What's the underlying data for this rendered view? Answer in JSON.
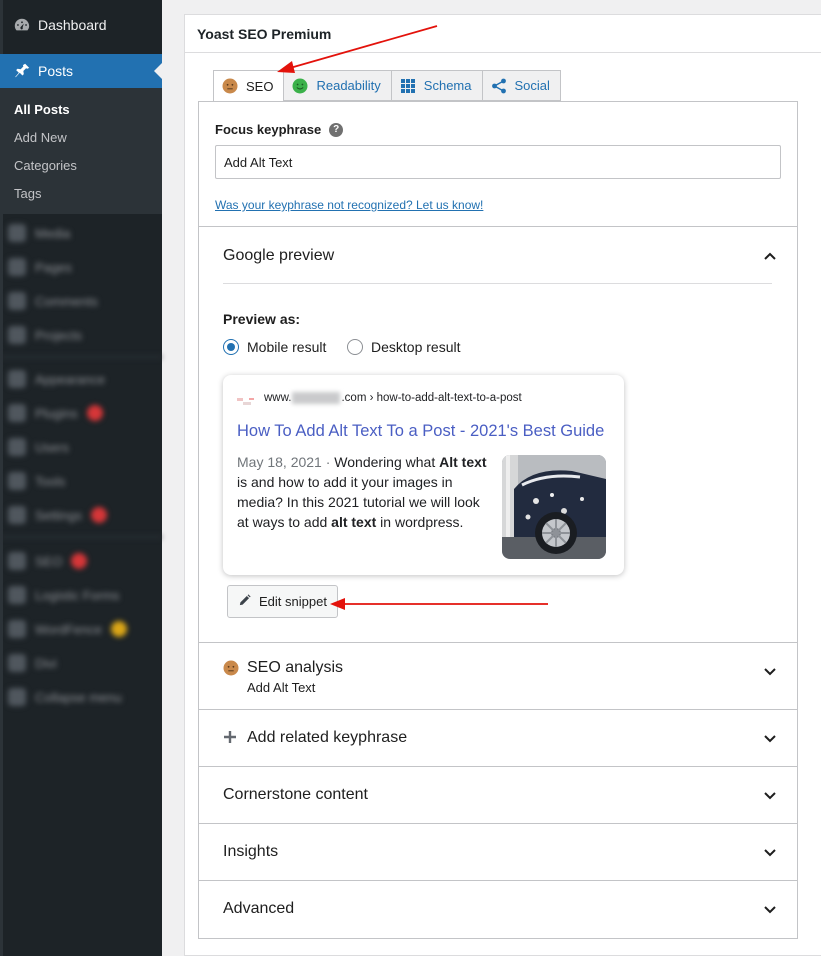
{
  "sidebar": {
    "dashboard_label": "Dashboard",
    "posts_label": "Posts",
    "submenu": [
      {
        "label": "All Posts",
        "current": true
      },
      {
        "label": "Add New",
        "current": false
      },
      {
        "label": "Categories",
        "current": false
      },
      {
        "label": "Tags",
        "current": false
      }
    ],
    "blurred_items": [
      "Media",
      "Pages",
      "Comments",
      "Projects",
      "Appearance",
      "Plugins",
      "Users",
      "Tools",
      "Settings",
      "SEO",
      "Logistic Forms",
      "WordFence",
      "Divi",
      "Collapse menu"
    ]
  },
  "yoast": {
    "title": "Yoast SEO Premium",
    "tabs": [
      {
        "label": "SEO",
        "icon": "face-neutral-icon",
        "active": true
      },
      {
        "label": "Readability",
        "icon": "face-smile-icon",
        "active": false
      },
      {
        "label": "Schema",
        "icon": "grid-icon",
        "active": false
      },
      {
        "label": "Social",
        "icon": "share-icon",
        "active": false
      }
    ],
    "focus_keyphrase_label": "Focus keyphrase",
    "focus_keyphrase_value": "Add Alt Text",
    "keyphrase_link": "Was your keyphrase not recognized? Let us know!",
    "google_preview": {
      "title": "Google preview",
      "preview_as_label": "Preview as:",
      "options": [
        "Mobile result",
        "Desktop result"
      ],
      "selected": "Mobile result",
      "serp": {
        "url_prefix": "www.",
        "url_suffix": ".com › how-to-add-alt-text-to-a-post",
        "title": "How To Add Alt Text To a Post - 2021's Best Guide",
        "date": "May 18, 2021",
        "separator": " · ",
        "desc_1": "Wondering what ",
        "desc_bold_1": "Alt text",
        "desc_2": " is and how to add it your images in media? In this 2021 tutorial we will look at ways to add ",
        "desc_bold_2": "alt text",
        "desc_3": " in wordpress."
      },
      "edit_snippet_label": "Edit snippet"
    },
    "seo_analysis": {
      "title": "SEO analysis",
      "subtitle": "Add Alt Text"
    },
    "related_keyphrase_label": "Add related keyphrase",
    "cornerstone_label": "Cornerstone content",
    "insights_label": "Insights",
    "advanced_label": "Advanced"
  },
  "colors": {
    "sidebar_bg": "#1d2327",
    "active_menu": "#2271b1",
    "link": "#2271b1",
    "serp_title": "#4a5ec3",
    "seo_score_orange": "#c9894b",
    "readability_green": "#3bb14a",
    "annotation_red": "#e3120b"
  }
}
